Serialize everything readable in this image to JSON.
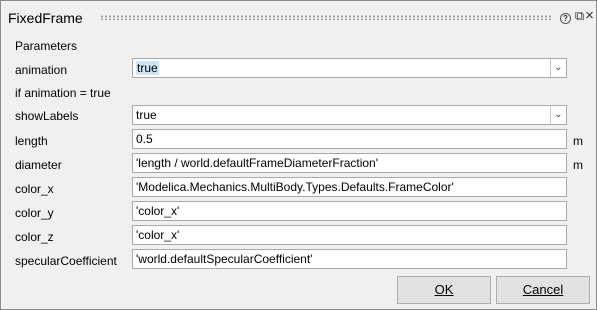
{
  "window": {
    "title": "FixedFrame"
  },
  "section": {
    "parameters_label": "Parameters",
    "if_animation_label": "if animation = true"
  },
  "params": {
    "animation": {
      "label": "animation",
      "value": "true"
    },
    "showLabels": {
      "label": "showLabels",
      "value": "true"
    },
    "length": {
      "label": "length",
      "value": "0.5",
      "unit": "m"
    },
    "diameter": {
      "label": "diameter",
      "value": "'length / world.defaultFrameDiameterFraction'",
      "unit": "m"
    },
    "color_x": {
      "label": "color_x",
      "value": "'Modelica.Mechanics.MultiBody.Types.Defaults.FrameColor'"
    },
    "color_y": {
      "label": "color_y",
      "value": "'color_x'"
    },
    "color_z": {
      "label": "color_z",
      "value": "'color_x'"
    },
    "specularCoefficient": {
      "label": "specularCoefficient",
      "value": "'world.defaultSpecularCoefficient'"
    }
  },
  "buttons": {
    "ok": "OK",
    "cancel": "Cancel"
  },
  "icons": {
    "help": "help-icon",
    "float": "float-icon",
    "close": "close-icon",
    "dropdown": "chevron-down-icon"
  }
}
